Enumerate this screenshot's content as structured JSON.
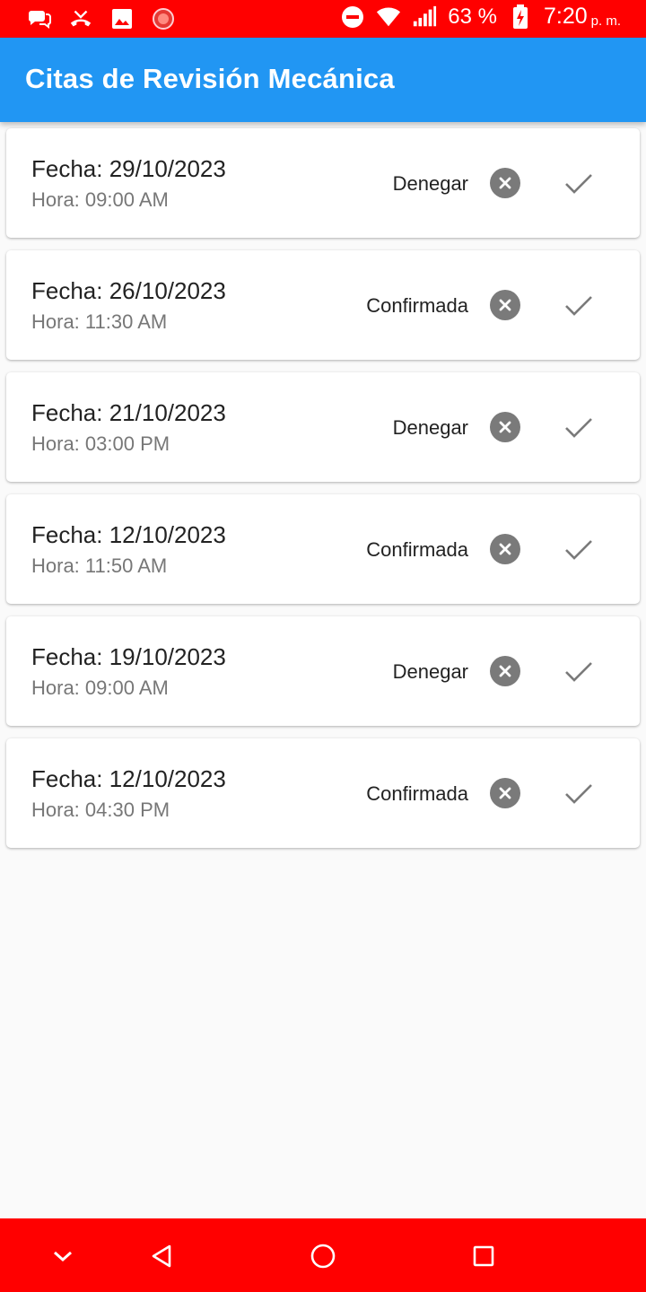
{
  "status_bar": {
    "battery": "63 %",
    "time": "7:20",
    "ampm": "p. m.",
    "left_icons": [
      "messages-icon",
      "missed-call-icon",
      "image-icon",
      "record-icon"
    ],
    "right_icons": [
      "do-not-disturb-icon",
      "wifi-icon",
      "signal-icon",
      "battery-charging-icon"
    ]
  },
  "app_bar": {
    "title": "Citas de Revisión Mecánica",
    "color": "#2196f3"
  },
  "appointments": [
    {
      "date": "Fecha: 29/10/2023",
      "time": "Hora: 09:00 AM",
      "status": "Denegar"
    },
    {
      "date": "Fecha: 26/10/2023",
      "time": "Hora: 11:30 AM",
      "status": "Confirmada"
    },
    {
      "date": "Fecha: 21/10/2023",
      "time": "Hora: 03:00 PM",
      "status": "Denegar"
    },
    {
      "date": "Fecha: 12/10/2023",
      "time": "Hora: 11:50 AM",
      "status": "Confirmada"
    },
    {
      "date": "Fecha: 19/10/2023",
      "time": "Hora: 09:00 AM",
      "status": "Denegar"
    },
    {
      "date": "Fecha: 12/10/2023",
      "time": "Hora: 04:30 PM",
      "status": "Confirmada"
    }
  ],
  "card_actions": {
    "cancel_icon": "cancel-circle-icon",
    "confirm_icon": "check-icon"
  },
  "nav_bar": {
    "buttons": [
      "collapse-icon",
      "back-icon",
      "home-icon",
      "recents-icon"
    ],
    "color": "#ff0000"
  }
}
